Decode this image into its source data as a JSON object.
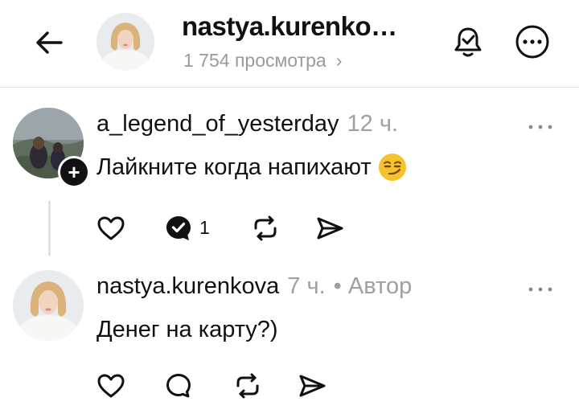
{
  "header": {
    "title": "nastya.kurenko…",
    "views": "1 754 просмотра",
    "views_chevron": "›"
  },
  "comments": [
    {
      "username": "a_legend_of_yesterday",
      "time": "12 ч.",
      "text": "Лайкните когда напихают",
      "emoji": "smirking-face-emoji",
      "follow_badge": "+",
      "reply_count": "1",
      "reply_icon": "reply-bubble-checked-icon"
    },
    {
      "username": "nastya.kurenkova",
      "time": "7 ч.",
      "author_label": "• Автор",
      "text": "Денег на карту?)",
      "reply_icon": "reply-bubble-icon"
    }
  ],
  "colors": {
    "text": "#111111",
    "muted": "#a0a0a0",
    "divider": "#e4e4e4",
    "emoji": "#f7c22a"
  }
}
